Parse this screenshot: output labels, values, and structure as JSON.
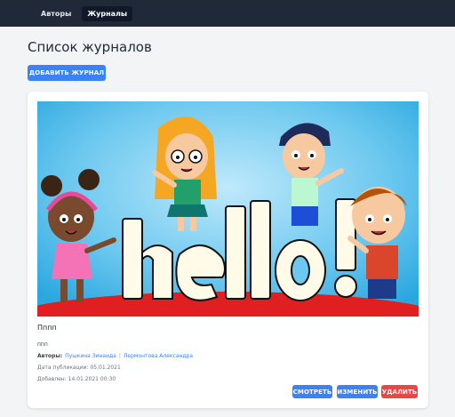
{
  "nav": {
    "items": [
      {
        "label": "Авторы"
      },
      {
        "label": "Журналы"
      }
    ]
  },
  "page": {
    "title": "Список журналов",
    "add_button": "Добавить журнал"
  },
  "magazine": {
    "cover_text": "hello!",
    "title": "Пппп",
    "description": "ппп",
    "authors_label": "Авторы:",
    "authors": [
      "Пушкина Зинаида",
      "Лермонтова Александра"
    ],
    "published": "Дата публикации: 05.01.2021",
    "added": "Добавлен: 14.01.2021 00:30",
    "actions": {
      "view": "Смотреть",
      "edit": "Изменить",
      "delete": "Удалить"
    }
  },
  "colors": {
    "nav_bg": "#1f2937",
    "primary": "#3b82f6",
    "danger": "#ef4444",
    "page_bg": "#f3f4f6"
  }
}
